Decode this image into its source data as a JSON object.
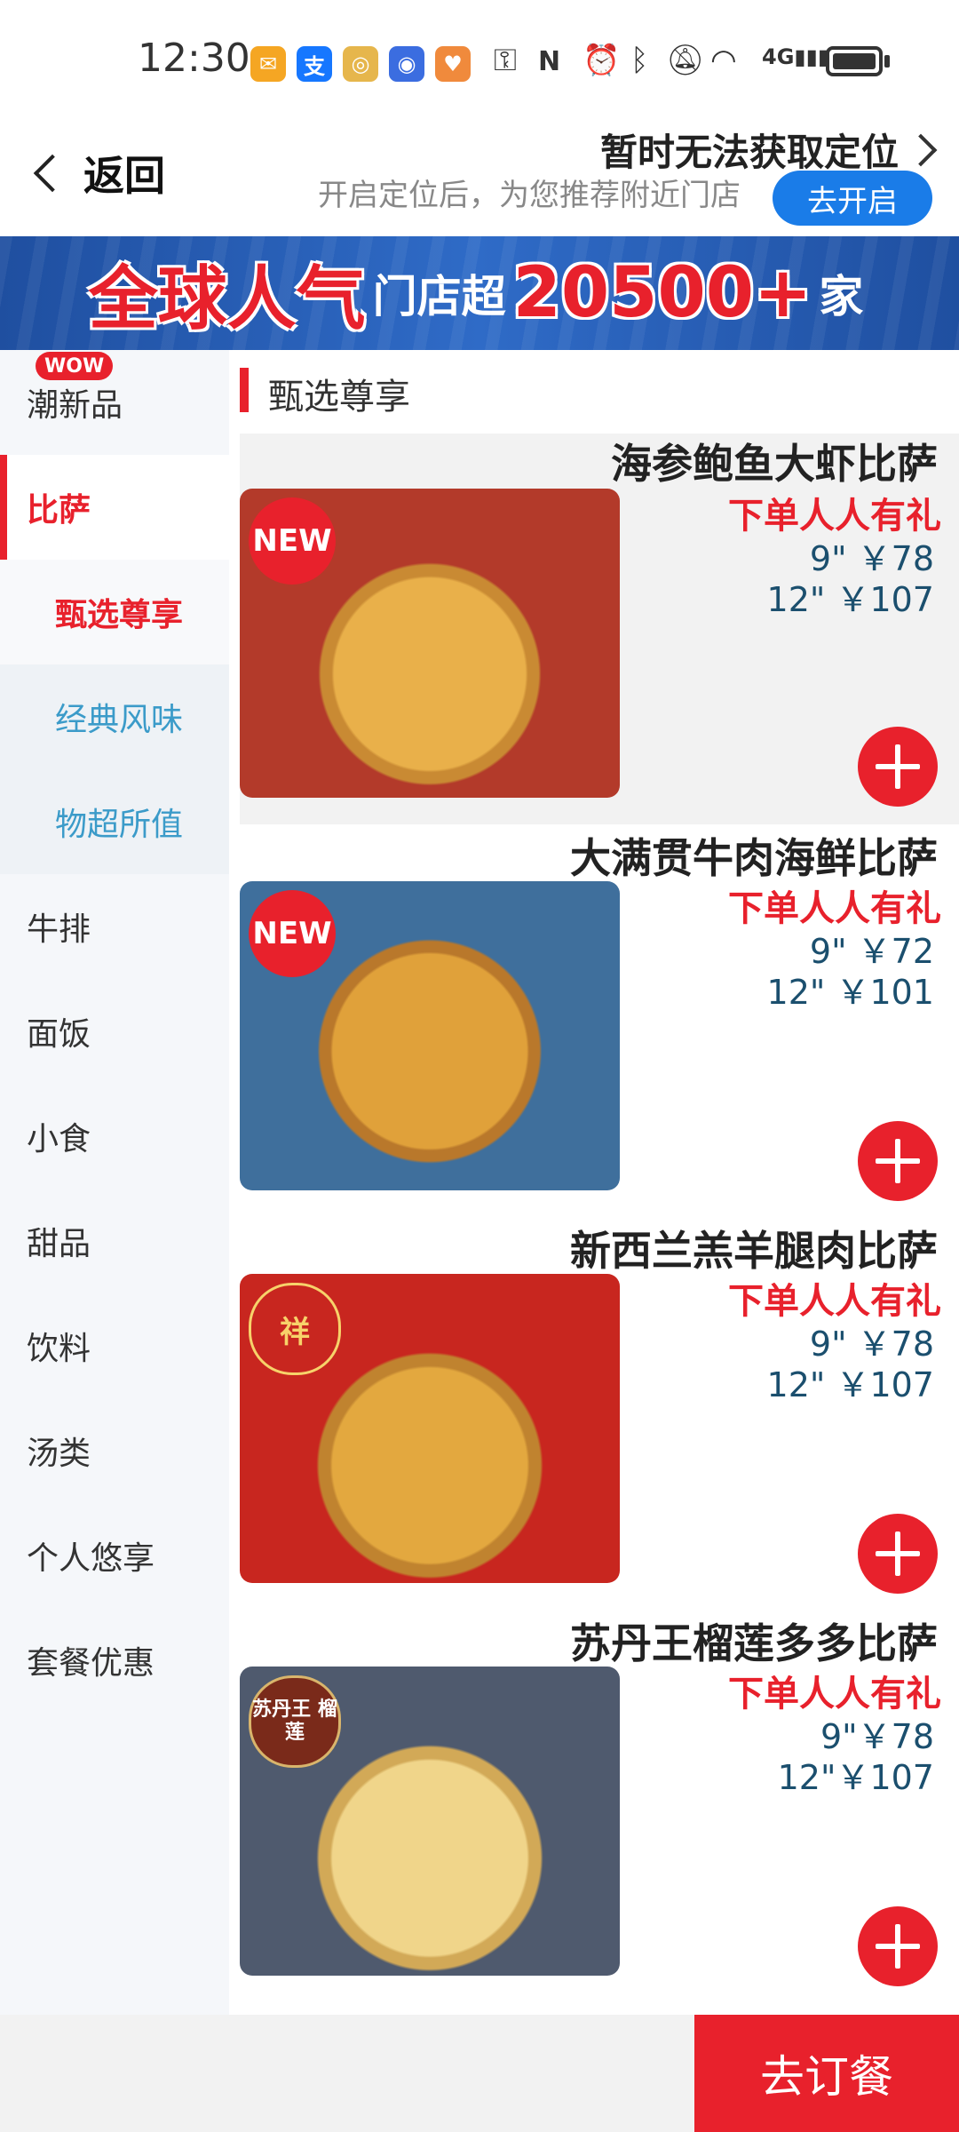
{
  "status_bar": {
    "time": "12:30",
    "app_icons": [
      {
        "name": "mail-icon",
        "color": "#f5a623",
        "glyph": "✉"
      },
      {
        "name": "alipay-icon",
        "color": "#1677ff",
        "glyph": "支"
      },
      {
        "name": "app-yellow-icon",
        "color": "#e6b64c",
        "glyph": "◎"
      },
      {
        "name": "app-blue-icon",
        "color": "#3b6de0",
        "glyph": "◉"
      },
      {
        "name": "app-orange-icon",
        "color": "#f08a3c",
        "glyph": "♥"
      }
    ],
    "system_icons": [
      "key-icon",
      "nfc-icon",
      "alarm-icon",
      "bluetooth-icon",
      "mute-icon",
      "wifi-icon",
      "4g-signal-icon",
      "battery-icon"
    ]
  },
  "header": {
    "back_label": "返回",
    "location_title": "暂时无法获取定位",
    "location_subtitle": "开启定位后，为您推荐附近门店",
    "location_button": "去开启"
  },
  "banner": {
    "text_big_1": "全球人气",
    "text_small_1": "门店超",
    "text_big_2": "20500+",
    "text_small_2": "家"
  },
  "sidebar": {
    "wow_badge": "WOW",
    "items": [
      {
        "label": "潮新品",
        "selected": false
      },
      {
        "label": "比萨",
        "selected": true
      },
      {
        "label": "甄选尊享",
        "selected": true,
        "sub": true
      },
      {
        "label": "经典风味",
        "selected": false,
        "sub": true
      },
      {
        "label": "物超所值",
        "selected": false,
        "sub": true
      },
      {
        "label": "牛排",
        "selected": false
      },
      {
        "label": "面饭",
        "selected": false
      },
      {
        "label": "小食",
        "selected": false
      },
      {
        "label": "甜品",
        "selected": false
      },
      {
        "label": "饮料",
        "selected": false
      },
      {
        "label": "汤类",
        "selected": false
      },
      {
        "label": "个人悠享",
        "selected": false
      },
      {
        "label": "套餐优惠",
        "selected": false
      }
    ]
  },
  "section": {
    "title": "甄选尊享"
  },
  "products": [
    {
      "name": "海参鲍鱼大虾比萨",
      "promo": "下单人人有礼",
      "price_9": "9\" ￥78",
      "price_12": "12\" ￥107",
      "badge": "NEW"
    },
    {
      "name": "大满贯牛肉海鲜比萨",
      "promo": "下单人人有礼",
      "price_9": "9\" ￥72",
      "price_12": "12\" ￥101",
      "badge": "NEW"
    },
    {
      "name": "新西兰羔羊腿肉比萨",
      "promo": "下单人人有礼",
      "price_9": "9\" ￥78",
      "price_12": "12\" ￥107",
      "badge": "祥"
    },
    {
      "name": "苏丹王榴莲多多比萨",
      "promo": "下单人人有礼",
      "price_9": "9\"￥78",
      "price_12": "12\"￥107",
      "badge": "苏丹王 榴莲"
    }
  ],
  "bottom": {
    "order_button": "去订餐"
  }
}
